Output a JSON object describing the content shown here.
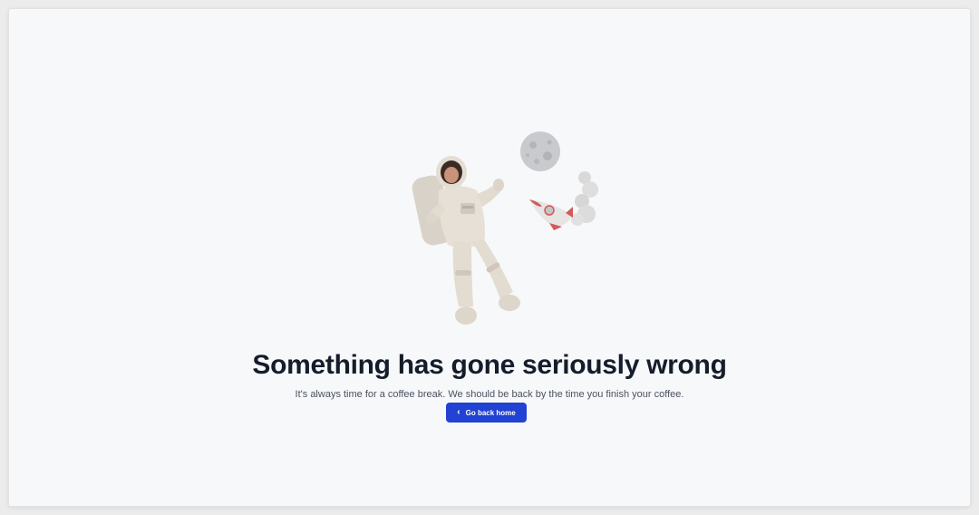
{
  "error_page": {
    "title": "Something has gone seriously wrong",
    "message": "It's always time for a coffee break. We should be back by the time you finish your coffee.",
    "home_button": {
      "label": "Go back home",
      "icon": "chevron-left-icon"
    },
    "illustration": {
      "elements": [
        "astronaut",
        "moon",
        "rocket"
      ]
    }
  },
  "colors": {
    "background": "#f7f8fa",
    "title": "#151c2b",
    "message": "#4a5160",
    "button": "#2142d3",
    "button_text": "#ffffff",
    "rocket_accent": "#d35a5a"
  }
}
